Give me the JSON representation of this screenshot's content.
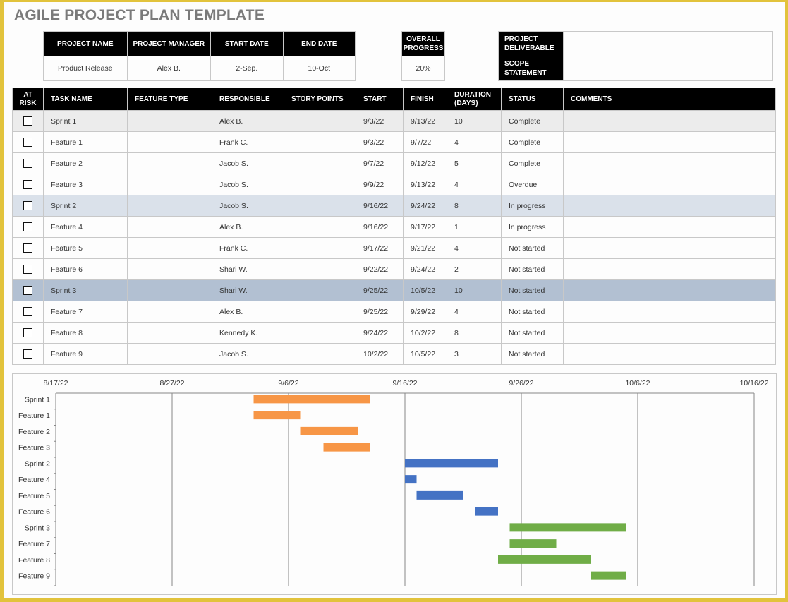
{
  "title": "AGILE PROJECT PLAN TEMPLATE",
  "project_info": {
    "headers": [
      "PROJECT NAME",
      "PROJECT MANAGER",
      "START DATE",
      "END DATE"
    ],
    "values": [
      "Product Release",
      "Alex B.",
      "2-Sep.",
      "10-Oct"
    ]
  },
  "progress": {
    "header_line1": "OVERALL",
    "header_line2": "PROGRESS",
    "value": "20%"
  },
  "deliverables": {
    "deliverable_line1": "PROJECT",
    "deliverable_line2": "DELIVERABLE",
    "deliverable_value": "",
    "scope_line1": "SCOPE",
    "scope_line2": "STATEMENT",
    "scope_value": ""
  },
  "task_table": {
    "headers": {
      "at_risk_1": "AT",
      "at_risk_2": "RISK",
      "task_name": "TASK NAME",
      "feature_type": "FEATURE TYPE",
      "responsible": "RESPONSIBLE",
      "story_points": "STORY POINTS",
      "start": "START",
      "finish": "FINISH",
      "duration_1": "DURATION",
      "duration_2": "(DAYS)",
      "status": "STATUS",
      "comments": "COMMENTS"
    },
    "rows": [
      {
        "at_risk": false,
        "task": "Sprint 1",
        "feature_type": "",
        "responsible": "Alex B.",
        "story_points": "",
        "start": "9/3/22",
        "finish": "9/13/22",
        "duration": "10",
        "status": "Complete",
        "comments": "",
        "kind": "sprint1"
      },
      {
        "at_risk": false,
        "task": "Feature 1",
        "feature_type": "",
        "responsible": "Frank C.",
        "story_points": "",
        "start": "9/3/22",
        "finish": "9/7/22",
        "duration": "4",
        "status": "Complete",
        "comments": "",
        "kind": "feature"
      },
      {
        "at_risk": false,
        "task": "Feature 2",
        "feature_type": "",
        "responsible": "Jacob S.",
        "story_points": "",
        "start": "9/7/22",
        "finish": "9/12/22",
        "duration": "5",
        "status": "Complete",
        "comments": "",
        "kind": "feature"
      },
      {
        "at_risk": false,
        "task": "Feature 3",
        "feature_type": "",
        "responsible": "Jacob S.",
        "story_points": "",
        "start": "9/9/22",
        "finish": "9/13/22",
        "duration": "4",
        "status": "Overdue",
        "comments": "",
        "kind": "feature"
      },
      {
        "at_risk": false,
        "task": "Sprint 2",
        "feature_type": "",
        "responsible": "Jacob S.",
        "story_points": "",
        "start": "9/16/22",
        "finish": "9/24/22",
        "duration": "8",
        "status": "In progress",
        "comments": "",
        "kind": "sprint2"
      },
      {
        "at_risk": false,
        "task": "Feature 4",
        "feature_type": "",
        "responsible": "Alex B.",
        "story_points": "",
        "start": "9/16/22",
        "finish": "9/17/22",
        "duration": "1",
        "status": "In progress",
        "comments": "",
        "kind": "feature"
      },
      {
        "at_risk": false,
        "task": "Feature 5",
        "feature_type": "",
        "responsible": "Frank C.",
        "story_points": "",
        "start": "9/17/22",
        "finish": "9/21/22",
        "duration": "4",
        "status": "Not started",
        "comments": "",
        "kind": "feature"
      },
      {
        "at_risk": false,
        "task": "Feature 6",
        "feature_type": "",
        "responsible": "Shari W.",
        "story_points": "",
        "start": "9/22/22",
        "finish": "9/24/22",
        "duration": "2",
        "status": "Not started",
        "comments": "",
        "kind": "feature"
      },
      {
        "at_risk": false,
        "task": "Sprint 3",
        "feature_type": "",
        "responsible": "Shari W.",
        "story_points": "",
        "start": "9/25/22",
        "finish": "10/5/22",
        "duration": "10",
        "status": "Not started",
        "comments": "",
        "kind": "sprint3"
      },
      {
        "at_risk": false,
        "task": "Feature 7",
        "feature_type": "",
        "responsible": "Alex B.",
        "story_points": "",
        "start": "9/25/22",
        "finish": "9/29/22",
        "duration": "4",
        "status": "Not started",
        "comments": "",
        "kind": "feature"
      },
      {
        "at_risk": false,
        "task": "Feature 8",
        "feature_type": "",
        "responsible": "Kennedy K.",
        "story_points": "",
        "start": "9/24/22",
        "finish": "10/2/22",
        "duration": "8",
        "status": "Not started",
        "comments": "",
        "kind": "feature"
      },
      {
        "at_risk": false,
        "task": "Feature 9",
        "feature_type": "",
        "responsible": "Jacob S.",
        "story_points": "",
        "start": "10/2/22",
        "finish": "10/5/22",
        "duration": "3",
        "status": "Not started",
        "comments": "",
        "kind": "feature"
      }
    ]
  },
  "colors": {
    "sprint1_group": "#f79646",
    "sprint2_group": "#4472c4",
    "sprint3_group": "#70ad47",
    "header_bg": "#000000",
    "sprint1_row": "#ececec",
    "sprint2_row": "#dae1ea",
    "sprint3_row": "#b2c0d2"
  },
  "chart_data": {
    "type": "bar",
    "subtype": "gantt",
    "title": "",
    "x_axis": {
      "type": "date",
      "min": "2022-08-17",
      "max": "2022-10-16",
      "tick_labels": [
        "8/17/22",
        "8/27/22",
        "9/6/22",
        "9/16/22",
        "9/26/22",
        "10/6/22",
        "10/16/22"
      ],
      "tick_dates": [
        "2022-08-17",
        "2022-08-27",
        "2022-09-06",
        "2022-09-16",
        "2022-09-26",
        "2022-10-06",
        "2022-10-16"
      ],
      "position": "top",
      "grid": true
    },
    "categories": [
      "Sprint 1",
      "Feature 1",
      "Feature 2",
      "Feature 3",
      "Sprint 2",
      "Feature 4",
      "Feature 5",
      "Feature 6",
      "Sprint 3",
      "Feature 7",
      "Feature 8",
      "Feature 9"
    ],
    "bars": [
      {
        "task": "Sprint 1",
        "start": "2022-09-03",
        "end": "2022-09-13",
        "group": "sprint1"
      },
      {
        "task": "Feature 1",
        "start": "2022-09-03",
        "end": "2022-09-07",
        "group": "sprint1"
      },
      {
        "task": "Feature 2",
        "start": "2022-09-07",
        "end": "2022-09-12",
        "group": "sprint1"
      },
      {
        "task": "Feature 3",
        "start": "2022-09-09",
        "end": "2022-09-13",
        "group": "sprint1"
      },
      {
        "task": "Sprint 2",
        "start": "2022-09-16",
        "end": "2022-09-24",
        "group": "sprint2"
      },
      {
        "task": "Feature 4",
        "start": "2022-09-16",
        "end": "2022-09-17",
        "group": "sprint2"
      },
      {
        "task": "Feature 5",
        "start": "2022-09-17",
        "end": "2022-09-21",
        "group": "sprint2"
      },
      {
        "task": "Feature 6",
        "start": "2022-09-22",
        "end": "2022-09-24",
        "group": "sprint2"
      },
      {
        "task": "Sprint 3",
        "start": "2022-09-25",
        "end": "2022-10-05",
        "group": "sprint3"
      },
      {
        "task": "Feature 7",
        "start": "2022-09-25",
        "end": "2022-09-29",
        "group": "sprint3"
      },
      {
        "task": "Feature 8",
        "start": "2022-09-24",
        "end": "2022-10-02",
        "group": "sprint3"
      },
      {
        "task": "Feature 9",
        "start": "2022-10-02",
        "end": "2022-10-05",
        "group": "sprint3"
      }
    ],
    "legend": "none"
  }
}
